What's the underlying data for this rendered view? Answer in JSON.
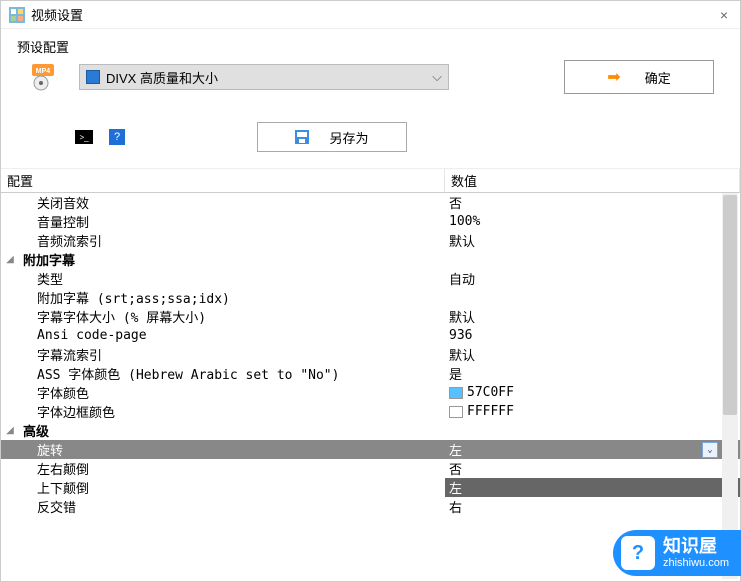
{
  "window": {
    "title": "视频设置",
    "close": "×"
  },
  "preset": {
    "section_label": "预设配置",
    "selected": "DIVX 高质量和大小",
    "ok_label": "确定",
    "saveas_label": "另存为",
    "help_glyph": "?",
    "cmd_glyph": ">_"
  },
  "grid": {
    "col_config": "配置",
    "col_value": "数值",
    "rows": [
      {
        "name": "关闭音效",
        "value": "否",
        "indent": true
      },
      {
        "name": "音量控制",
        "value": "100%",
        "indent": true
      },
      {
        "name": "音频流索引",
        "value": "默认",
        "indent": true
      },
      {
        "name": "附加字幕",
        "value": "",
        "group": true,
        "expander": "◢"
      },
      {
        "name": "类型",
        "value": "自动",
        "indent": true
      },
      {
        "name": "附加字幕 (srt;ass;ssa;idx)",
        "value": "",
        "indent": true
      },
      {
        "name": "字幕字体大小 (% 屏幕大小)",
        "value": "默认",
        "indent": true
      },
      {
        "name": "Ansi code-page",
        "value": "936",
        "indent": true
      },
      {
        "name": "字幕流索引",
        "value": "默认",
        "indent": true
      },
      {
        "name": "ASS 字体颜色 (Hebrew Arabic set to \"No\")",
        "value": "是",
        "indent": true
      },
      {
        "name": "字体颜色",
        "value": "57C0FF",
        "indent": true,
        "swatch": "#57C0FF"
      },
      {
        "name": "字体边框颜色",
        "value": "FFFFFF",
        "indent": true,
        "swatch": "#FFFFFF"
      },
      {
        "name": "高级",
        "value": "",
        "group": true,
        "expander": "◢"
      },
      {
        "name": "旋转",
        "value": "左",
        "indent": true,
        "selected": true,
        "dropdown": true
      },
      {
        "name": "左右颠倒",
        "value": "否",
        "indent": true
      },
      {
        "name": "上下颠倒",
        "value": "左",
        "indent": true,
        "val_highlight": true
      },
      {
        "name": "反交错",
        "value": "右",
        "indent": true
      }
    ]
  },
  "watermark": {
    "title": "知识屋",
    "url": "zhishiwu.com",
    "glyph": "?"
  }
}
